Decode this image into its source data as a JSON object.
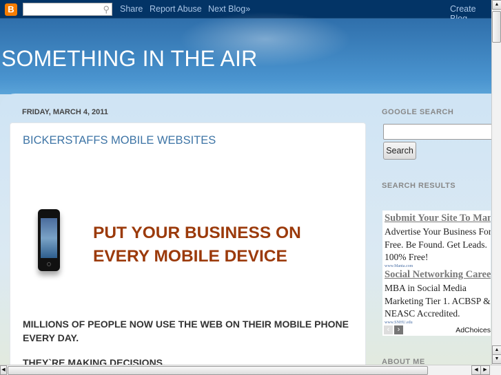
{
  "navbar": {
    "logo": "B",
    "search_placeholder": "",
    "links": [
      "Share",
      "Report Abuse",
      "Next Blog»"
    ],
    "create": "Create Blog"
  },
  "blog": {
    "title": "SOMETHING IN THE AIR"
  },
  "post": {
    "date": "FRIDAY, MARCH 4, 2011",
    "title": "BICKERSTAFFS MOBILE WEBSITES",
    "promo_lines": [
      "PUT YOUR BUSINESS ON",
      "EVERY MOBILE DEVICE"
    ],
    "paragraphs": [
      "MILLIONS OF PEOPLE NOW USE THE WEB ON THEIR MOBILE PHONE",
      "EVERY DAY.",
      "THEY`RE MAKING DECISIONS."
    ]
  },
  "sidebar": {
    "google_search": "GOOGLE SEARCH",
    "search_button": "Search",
    "search_results": "SEARCH RESULTS",
    "about_me": "ABOUT ME"
  },
  "ads": [
    {
      "headline": "Submit Your Site To Manta",
      "lines": [
        "Advertise Your Business For",
        "Free. Be Found. Get Leads.",
        "100% Free!"
      ],
      "url": "www.Manta.com"
    },
    {
      "headline": "Social Networking Careers",
      "lines": [
        "MBA in Social Media",
        "Marketing Tier 1. ACBSP &",
        "NEASC Accredited."
      ],
      "url": "www.SNHU.edu"
    }
  ],
  "adchoices": "AdChoices"
}
